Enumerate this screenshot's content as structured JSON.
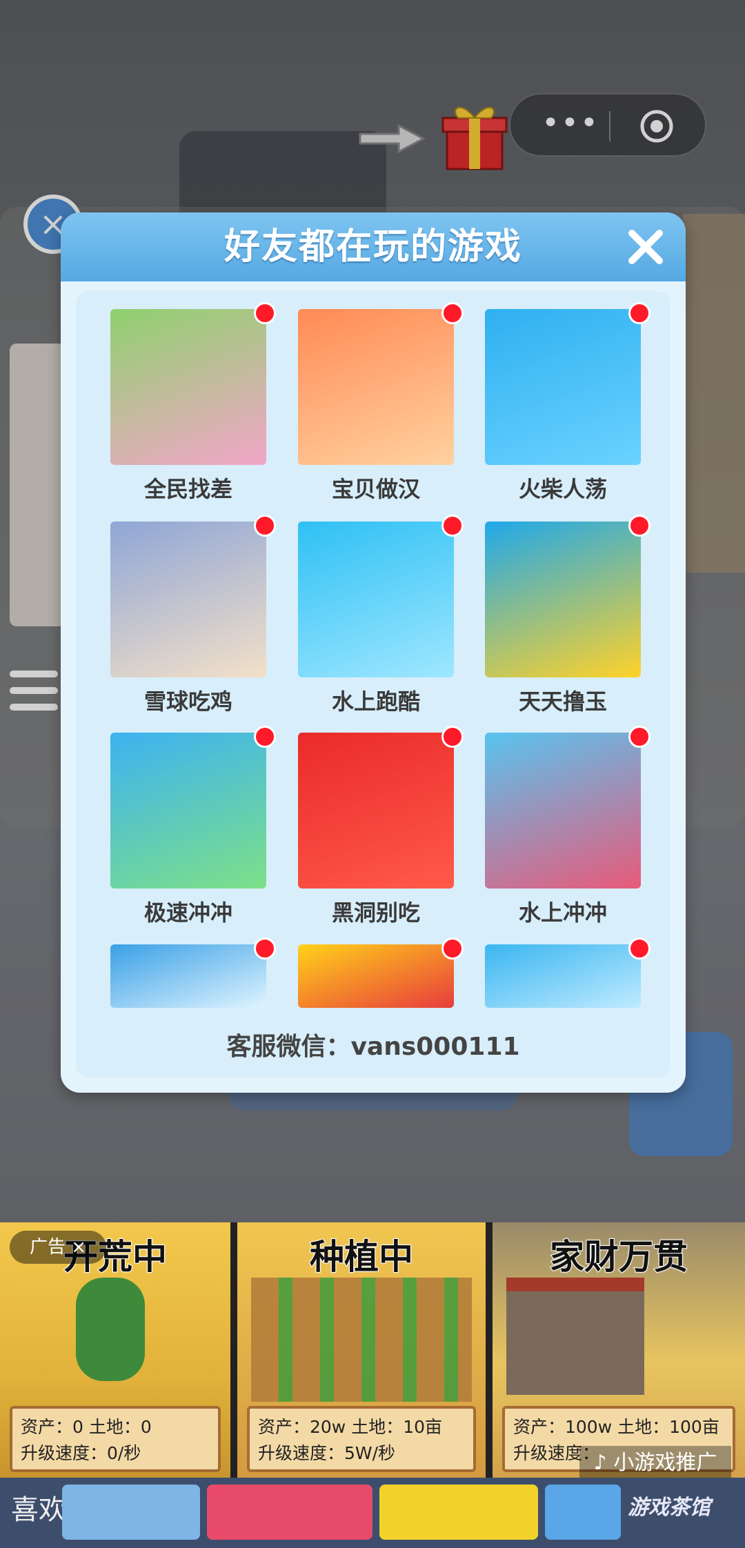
{
  "popup": {
    "title": "好友都在玩的游戏",
    "service": "客服微信：vans000111"
  },
  "games": [
    {
      "label": "全民找差",
      "icon": "find-difference-icon",
      "colors": [
        "#8fd16e",
        "#f2a6c8"
      ]
    },
    {
      "label": "宝贝做汉",
      "icon": "burger-icon",
      "colors": [
        "#ff8a55",
        "#ffd2a0"
      ]
    },
    {
      "label": "火柴人荡",
      "icon": "stickman-swing-icon",
      "colors": [
        "#2fb0f0",
        "#6ad2ff"
      ]
    },
    {
      "label": "雪球吃鸡",
      "icon": "characters-icon",
      "colors": [
        "#8fa6d6",
        "#f3e0c8"
      ]
    },
    {
      "label": "水上跑酷",
      "icon": "water-run-icon",
      "colors": [
        "#2ec0f4",
        "#9fe7ff"
      ]
    },
    {
      "label": "天天撸玉",
      "icon": "corn-icon",
      "colors": [
        "#1fa8ea",
        "#ffd22a"
      ]
    },
    {
      "label": "极速冲冲",
      "icon": "race-icon",
      "colors": [
        "#3db2f2",
        "#7de088"
      ]
    },
    {
      "label": "黑洞别吃",
      "icon": "black-hole-icon",
      "colors": [
        "#ea2a2a",
        "#ff5a4a"
      ]
    },
    {
      "label": "水上冲冲",
      "icon": "slide-icon",
      "colors": [
        "#58c4f0",
        "#e85a7a"
      ]
    },
    {
      "label": "",
      "icon": "ice-icon",
      "colors": [
        "#3aa0e6",
        "#dff4ff"
      ]
    },
    {
      "label": "",
      "icon": "blocks-icon",
      "colors": [
        "#ffd21a",
        "#e83c3c"
      ]
    },
    {
      "label": "",
      "icon": "stickman-icon",
      "colors": [
        "#3ab6f0",
        "#bfeaff"
      ]
    }
  ],
  "ad": {
    "label": "广告 ×",
    "promo": "♪ 小游戏推广",
    "cards": [
      {
        "title": "开荒中",
        "line1": "资产：0    土地：0",
        "line2": "升级速度：0/秒"
      },
      {
        "title": "种植中",
        "line1": "资产：20w    土地：10亩",
        "line2": "升级速度：5W/秒"
      },
      {
        "title": "家财万贯",
        "line1": "资产：100w 土地：100亩",
        "line2": "升级速度："
      }
    ]
  },
  "bottom": {
    "text": "喜欢",
    "watermark": "游戏茶馆"
  }
}
